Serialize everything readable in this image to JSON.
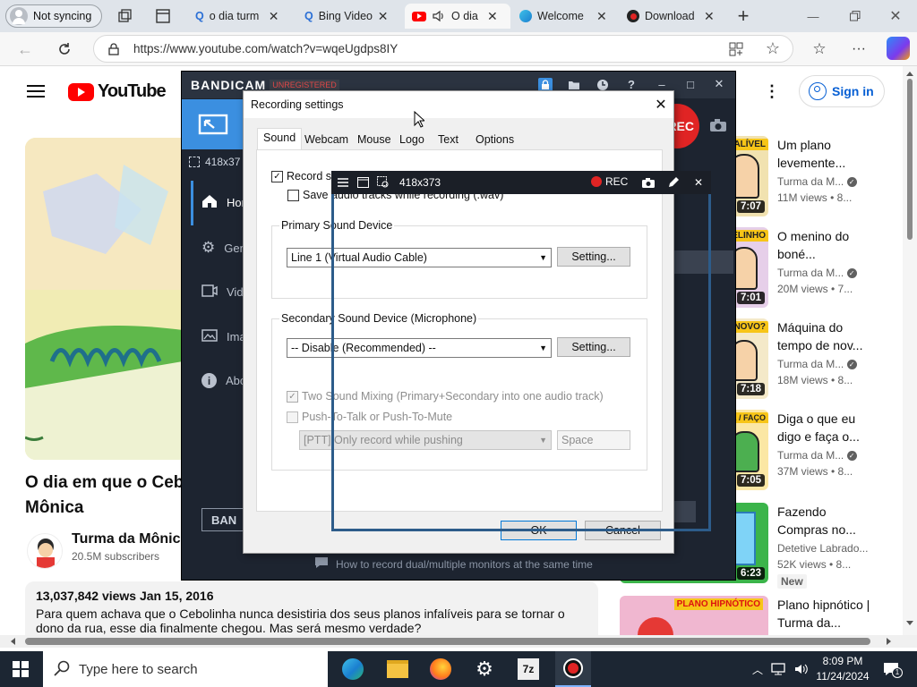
{
  "browser": {
    "profile_label": "Not syncing",
    "tabs": [
      {
        "label": "o dia turm"
      },
      {
        "label": "Bing Video"
      },
      {
        "label": "O dia"
      },
      {
        "label": "Welcome"
      },
      {
        "label": "Download"
      }
    ],
    "url": "https://www.youtube.com/watch?v=wqeUgdps8IY"
  },
  "youtube": {
    "logo_text": "YouTube",
    "sign_in": "Sign in",
    "video_title_line1": "O dia em que o Ceb",
    "video_title_line2": "Mônica",
    "channel_name": "Turma da Mônica",
    "subscribers": "20.5M subscribers",
    "views_date": "13,037,842 views  Jan 15, 2016",
    "description_line1": "Para quem achava que o Cebolinha nunca desistiria dos seus planos infalíveis para se tornar o",
    "description_line2": "dono da rua, esse dia finalmente chegou. Mas será mesmo verdade?",
    "recommendations": [
      {
        "title": "Um plano levemente...",
        "channel": "Turma da M...",
        "views": "11M views • 8...",
        "duration": "7:07",
        "badge": "ALÍVEL"
      },
      {
        "title": "O menino do boné...",
        "channel": "Turma da M...",
        "views": "20M views • 7...",
        "duration": "7:01",
        "badge": "ELINHO"
      },
      {
        "title": "Máquina do tempo de nov...",
        "channel": "Turma da M...",
        "views": "18M views • 8...",
        "duration": "7:18",
        "badge": "NOVO?"
      },
      {
        "title": "Diga o que eu digo e faça o...",
        "channel": "Turma da M...",
        "views": "37M views • 8...",
        "duration": "7:05",
        "badge": "DIGO E / FAÇO"
      },
      {
        "title": "Fazendo Compras no...",
        "channel": "Detetive Labrado...",
        "views": "52K views • 8...",
        "duration": "6:23",
        "badge": "",
        "extra": "New"
      },
      {
        "title": "Plano hipnótico | Turma da...",
        "channel": "",
        "views": "",
        "duration": "",
        "badge": "PLANO HIPNÓTICO"
      }
    ]
  },
  "bandicam": {
    "brand": "BANDICAM",
    "unregistered": "UNREGISTERED",
    "size_label": "418x37",
    "sidebar": [
      "Hor",
      "Gen",
      "Vide",
      "Ima",
      "Abo"
    ],
    "rec_label": "REC",
    "bottom_button": "BAN",
    "footer_tip": "How to record dual/multiple monitors at the same time"
  },
  "dialog": {
    "title": "Recording settings",
    "tabs": [
      "Sound",
      "Webcam",
      "Mouse",
      "Logo",
      "Text",
      "Options"
    ],
    "record_sound": "Record so",
    "save_tracks": "Save audio tracks while recording (.wav)",
    "primary_group": "Primary Sound Device",
    "primary_device": "Line 1 (Virtual Audio Cable)",
    "setting_btn": "Setting...",
    "secondary_group": "Secondary Sound Device (Microphone)",
    "secondary_device": "-- Disable (Recommended) --",
    "two_sound": "Two Sound Mixing (Primary+Secondary into one audio track)",
    "ptt": "Push-To-Talk or Push-To-Mute",
    "ptt_mode": "[PTT] Only record while pushing",
    "ptt_key": "Space",
    "ok": "OK",
    "cancel": "Cancel"
  },
  "overlay": {
    "size": "418x373",
    "rec": "REC"
  },
  "taskbar": {
    "search_placeholder": "Type here to search",
    "time": "8:09 PM",
    "date": "11/24/2024",
    "notif_count": "1"
  },
  "colors": {
    "youtube_red": "#ff0000",
    "bandicam_blue": "#3b8fe0",
    "rec_red": "#e02424",
    "taskbar": "#1c2633"
  }
}
